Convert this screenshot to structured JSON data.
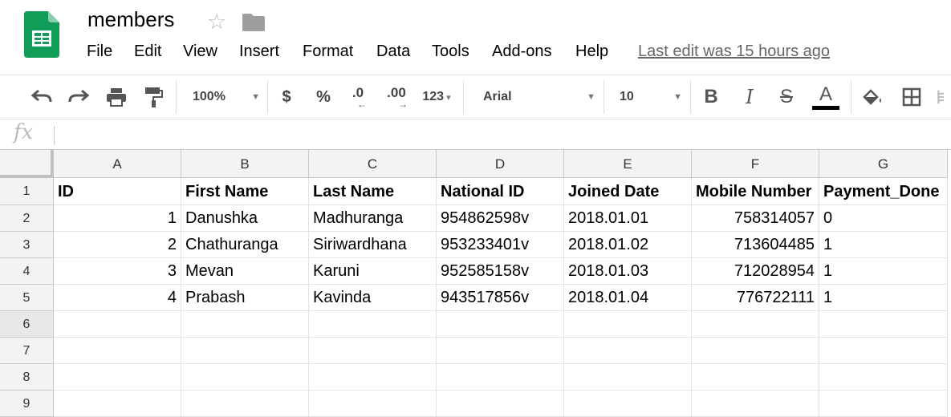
{
  "app": {
    "title": "members",
    "menu": [
      "File",
      "Edit",
      "View",
      "Insert",
      "Format",
      "Data",
      "Tools",
      "Add-ons",
      "Help"
    ],
    "last_edit": "Last edit was 15 hours ago"
  },
  "toolbar": {
    "zoom": "100%",
    "currency": "$",
    "percent": "%",
    "decrease_decimal": ".0",
    "increase_decimal": ".00",
    "more_formats": "123",
    "font": "Arial",
    "font_size": "10",
    "bold": "B",
    "italic": "I",
    "strikethrough": "S",
    "text_color_label": "A"
  },
  "formula_bar": {
    "label": "fx",
    "value": ""
  },
  "sheet": {
    "columns": [
      "A",
      "B",
      "C",
      "D",
      "E",
      "F",
      "G"
    ],
    "rows": [
      "1",
      "2",
      "3",
      "4",
      "5",
      "6",
      "7",
      "8",
      "9"
    ],
    "header": [
      "ID",
      "First Name",
      "Last Name",
      "National ID",
      "Joined Date",
      "Mobile Number",
      "Payment_Done"
    ],
    "data": [
      [
        "1",
        "Danushka",
        "Madhuranga",
        "954862598v",
        "2018.01.01",
        "758314057",
        "0"
      ],
      [
        "2",
        "Chathuranga",
        "Siriwardhana",
        "953233401v",
        "2018.01.02",
        "713604485",
        "1"
      ],
      [
        "3",
        "Mevan",
        "Karuni",
        "952585158v",
        "2018.01.03",
        "712028954",
        "1"
      ],
      [
        "4",
        "Prabash",
        "Kavinda",
        "943517856v",
        "2018.01.04",
        "776722111",
        "1"
      ]
    ]
  }
}
